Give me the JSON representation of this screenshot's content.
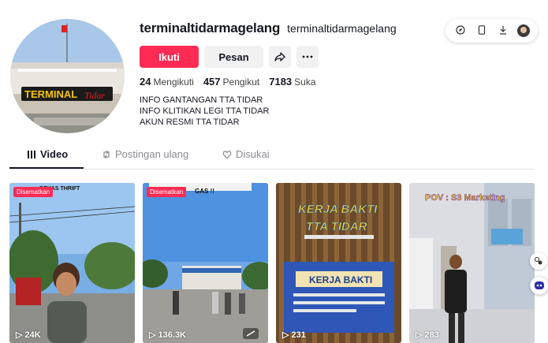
{
  "profile": {
    "username": "terminaltidarmagelang",
    "nickname": "terminaltidarmagelang",
    "follow_label": "Ikuti",
    "message_label": "Pesan",
    "share_icon": "share-icon",
    "more_icon": "more-icon",
    "stats": [
      {
        "value": "24",
        "label": "Mengikuti"
      },
      {
        "value": "457",
        "label": "Pengikut"
      },
      {
        "value": "7183",
        "label": "Suka"
      }
    ],
    "bio": [
      "INFO GANTANGAN TTA TIDAR",
      "INFO KLITIKAN LEGI TTA TIDAR",
      "AKUN RESMI TTA TIDAR"
    ],
    "avatar_sign_text": "TERMINAL"
  },
  "tabs": [
    {
      "label": "Video",
      "icon": "grid-icon",
      "active": true
    },
    {
      "label": "Postingan ulang",
      "icon": "repost-icon",
      "active": false
    },
    {
      "label": "Disukai",
      "icon": "heart-icon",
      "active": false
    }
  ],
  "videos": [
    {
      "pinned": "Disematkan",
      "views": "24K",
      "overlay": "BEKAS THRIFT"
    },
    {
      "pinned": "Disematkan",
      "views": "136.3K",
      "overlay": "GAS !!"
    },
    {
      "pinned": "",
      "views": "231",
      "overlay": "KERJA BAKTI",
      "overlay2": "TTA TIDAR",
      "banner": "KERJA BAKTI"
    },
    {
      "pinned": "",
      "views": "283",
      "overlay": "POV : S3 Marketing"
    }
  ],
  "play_glyph": "▷",
  "colors": {
    "accent": "#fe2c55",
    "text": "#161823",
    "muted": "#8a8b91"
  }
}
